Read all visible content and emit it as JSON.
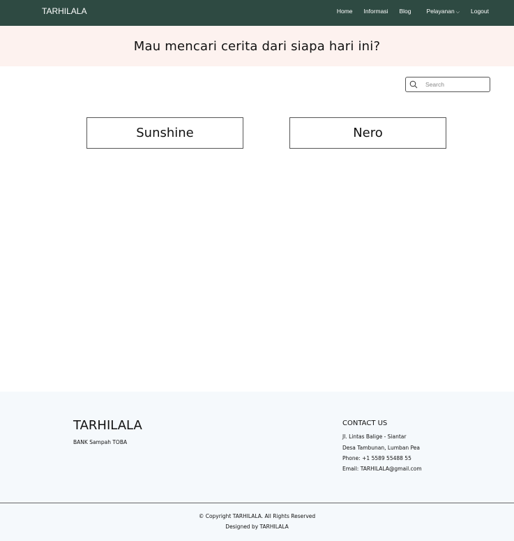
{
  "navbar": {
    "brand": "TARHILALA",
    "links": [
      "Home",
      "Informasi",
      "Blog"
    ],
    "dropdown_label": "Pelayanan",
    "logout_label": "Logout",
    "background": "#2e4a42"
  },
  "hero": {
    "title": "Mau mencari cerita dari siapa hari ini?",
    "background": "#fdf2ef"
  },
  "search": {
    "placeholder": "Search",
    "icon": "search-icon"
  },
  "cards": [
    {
      "label": "Sunshine"
    },
    {
      "label": "Nero"
    }
  ],
  "footer": {
    "brand": "TARHILALA",
    "subtitle": "BANK Sampah TOBA",
    "contact_title": "CONTACT US",
    "address_1": "Jl. Lintas Balige - Siantar",
    "address_2": "Desa Tambunan, Lumban Pea",
    "phone": "Phone: +1 5589 55488 55",
    "email_prefix": "Email: ",
    "email": "TARHILALA@gmail.com",
    "copyright": "© Copyright TARHILALA. All Rights Reserved",
    "designed_prefix": "Designed by ",
    "designed_by": "TARHILALA",
    "background": "#f5f9fc"
  }
}
